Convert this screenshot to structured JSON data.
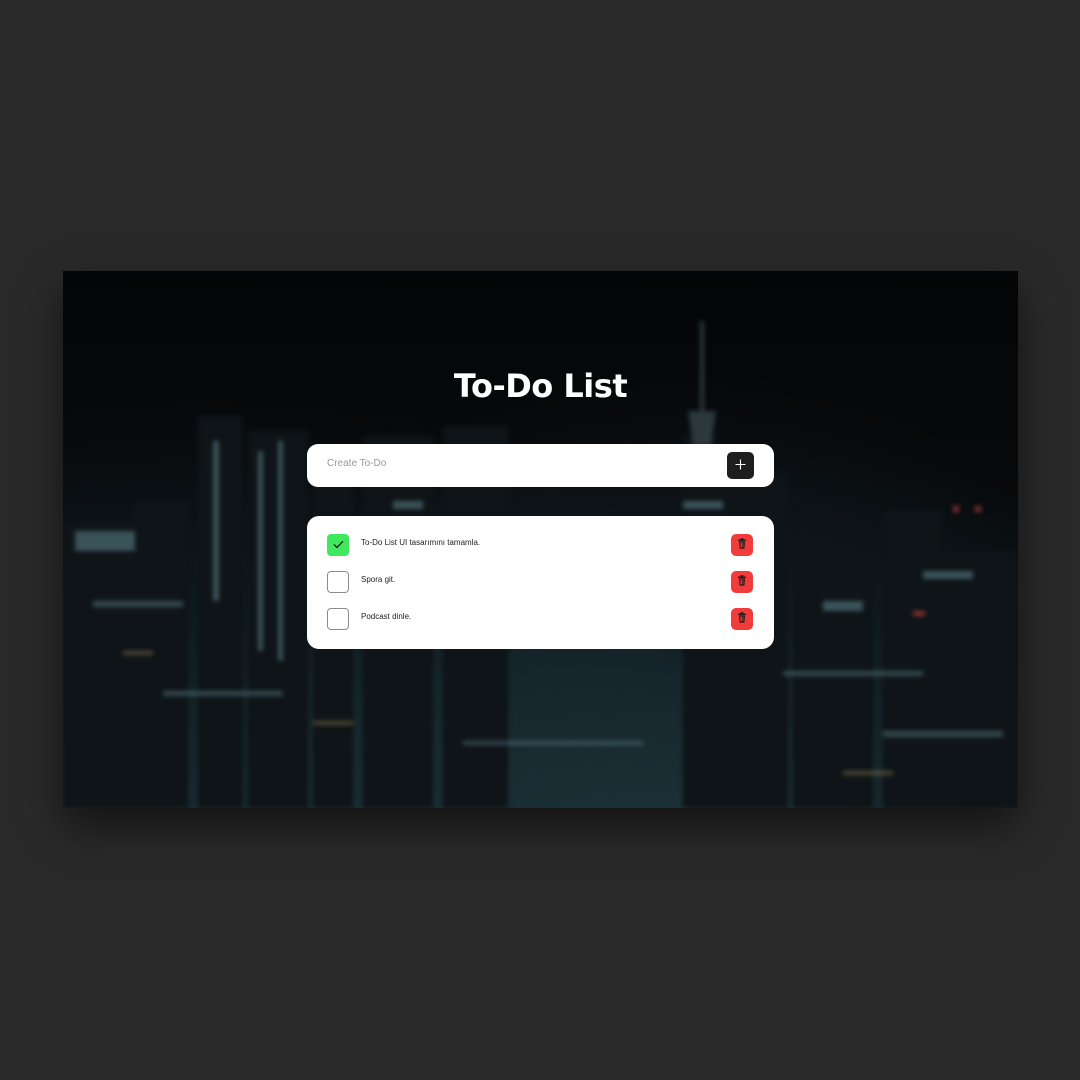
{
  "app": {
    "title": "To-Do List"
  },
  "create": {
    "placeholder": "Create To-Do",
    "value": "",
    "add_icon": "plus-icon"
  },
  "todos": [
    {
      "text": "To-Do List UI tasarımını tamamla.",
      "completed": true
    },
    {
      "text": "Spora git.",
      "completed": false
    },
    {
      "text": "Podcast dinle.",
      "completed": false
    }
  ],
  "icons": {
    "check": "check-icon",
    "delete": "trash-icon"
  },
  "colors": {
    "page_background": "#2a2a2a",
    "card": "#ffffff",
    "add_button": "#1e1e1e",
    "checked": "#3fe85c",
    "delete_button": "#f23b3b",
    "title": "#ffffff"
  }
}
